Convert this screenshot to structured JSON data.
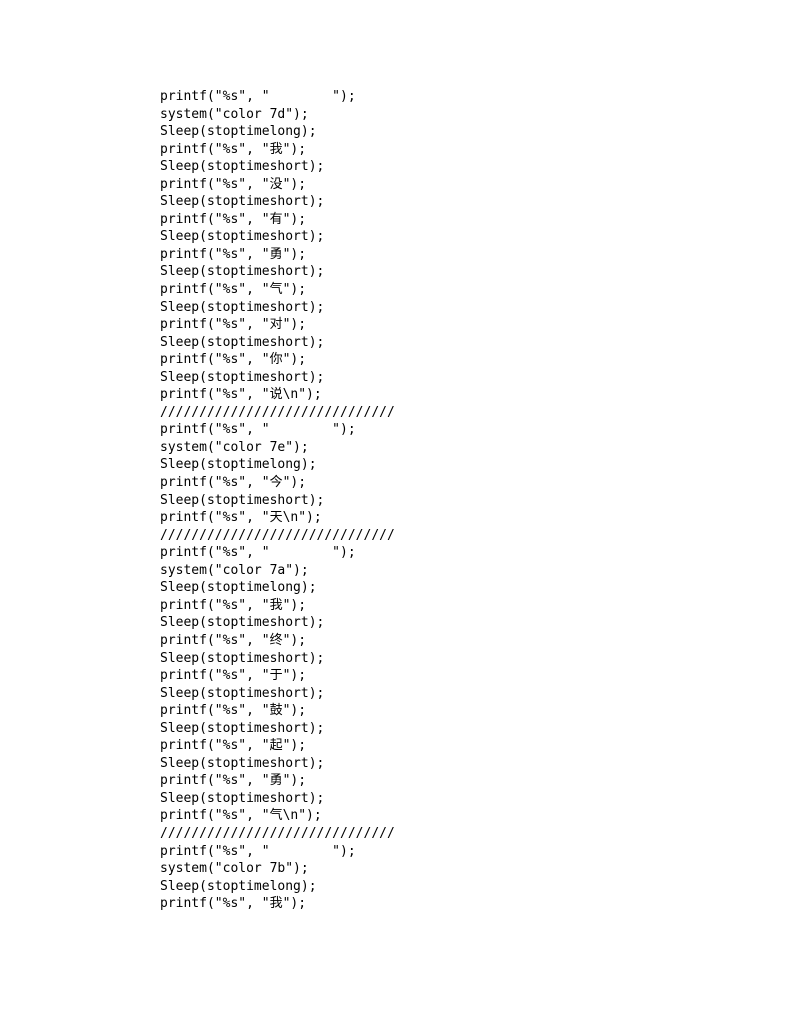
{
  "lines": [
    "printf(\"%s\", \"        \");",
    "system(\"color 7d\");",
    "Sleep(stoptimelong);",
    "printf(\"%s\", \"我\");",
    "Sleep(stoptimeshort);",
    "printf(\"%s\", \"没\");",
    "Sleep(stoptimeshort);",
    "printf(\"%s\", \"有\");",
    "Sleep(stoptimeshort);",
    "printf(\"%s\", \"勇\");",
    "Sleep(stoptimeshort);",
    "printf(\"%s\", \"气\");",
    "Sleep(stoptimeshort);",
    "printf(\"%s\", \"对\");",
    "Sleep(stoptimeshort);",
    "printf(\"%s\", \"你\");",
    "Sleep(stoptimeshort);",
    "printf(\"%s\", \"说\\n\");",
    "//////////////////////////////",
    "printf(\"%s\", \"        \");",
    "system(\"color 7e\");",
    "Sleep(stoptimelong);",
    "printf(\"%s\", \"今\");",
    "Sleep(stoptimeshort);",
    "printf(\"%s\", \"天\\n\");",
    "//////////////////////////////",
    "printf(\"%s\", \"        \");",
    "system(\"color 7a\");",
    "Sleep(stoptimelong);",
    "printf(\"%s\", \"我\");",
    "Sleep(stoptimeshort);",
    "printf(\"%s\", \"终\");",
    "Sleep(stoptimeshort);",
    "printf(\"%s\", \"于\");",
    "Sleep(stoptimeshort);",
    "printf(\"%s\", \"鼓\");",
    "Sleep(stoptimeshort);",
    "printf(\"%s\", \"起\");",
    "Sleep(stoptimeshort);",
    "printf(\"%s\", \"勇\");",
    "Sleep(stoptimeshort);",
    "printf(\"%s\", \"气\\n\");",
    "//////////////////////////////",
    "printf(\"%s\", \"        \");",
    "system(\"color 7b\");",
    "Sleep(stoptimelong);",
    "printf(\"%s\", \"我\");"
  ]
}
